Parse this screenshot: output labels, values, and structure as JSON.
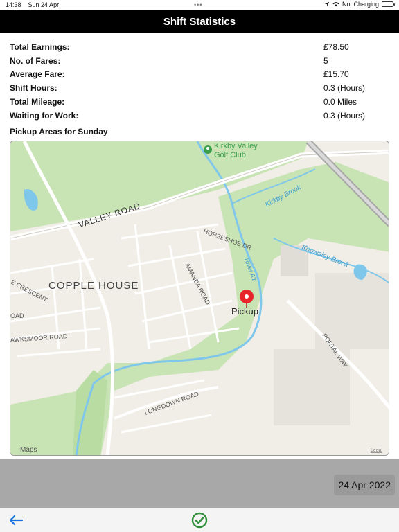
{
  "status": {
    "time": "14:38",
    "date": "Sun 24 Apr",
    "dots": "•••",
    "charging": "Not Charging"
  },
  "nav": {
    "title": "Shift Statistics"
  },
  "stats": [
    {
      "label": "Total Earnings:",
      "value": "£78.50"
    },
    {
      "label": "No. of Fares:",
      "value": "5"
    },
    {
      "label": "Average Fare:",
      "value": "£15.70"
    },
    {
      "label": "Shift Hours:",
      "value": "0.3 (Hours)"
    },
    {
      "label": "Total Mileage:",
      "value": "0.0 Miles"
    },
    {
      "label": "Waiting for Work:",
      "value": "0.3 (Hours)"
    }
  ],
  "section_title": "Pickup Areas for Sunday",
  "map": {
    "labels": {
      "golf": "Kirkby Valley",
      "golf2": "Golf Club",
      "valley_road": "VALLEY ROAD",
      "kirkby_brook": "Kirkby Brook",
      "knowsley_brook": "Knowsley Brook",
      "horseshoe": "HORSESHOE DR",
      "river_alt": "River Alt",
      "copple_house": "COPPLE HOUSE",
      "crescent": "E CRESCENT",
      "amanda": "AMANDA ROAD",
      "oad": "OAD",
      "hawksmoor": "AWKSMOOR ROAD",
      "portal": "PORTAL WAY",
      "longdown": "LONGDOWN ROAD",
      "pin": "Pickup",
      "attribution": "Maps",
      "legal": "Legal"
    },
    "colors": {
      "water": "#7fc7ea",
      "park": "#c8e3b4",
      "land": "#f1eee7",
      "road": "#ffffff",
      "pin": "#e8232a"
    }
  },
  "date_bar": {
    "date": "24 Apr 2022"
  },
  "bottom": {
    "back_icon": "arrow-left-icon",
    "confirm_icon": "check-circle-icon"
  }
}
